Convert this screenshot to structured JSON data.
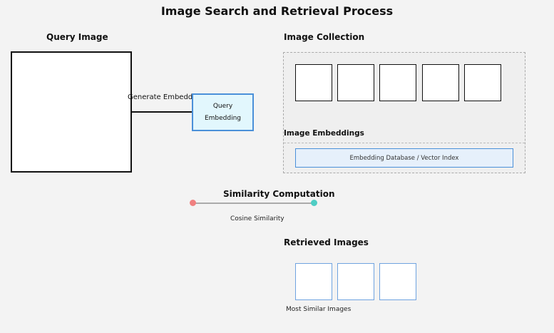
{
  "title": "Image Search and Retrieval Process",
  "query": {
    "label": "Query Image",
    "generate_label": "Generate Embeddings",
    "embedding_lines": [
      "Query",
      "Embedding"
    ]
  },
  "collection": {
    "label": "Image Collection",
    "thumbnail_count": 5,
    "embeddings_label": "Image Embeddings",
    "database_label": "Embedding Database / Vector Index"
  },
  "similarity": {
    "label": "Similarity Computation",
    "method_label": "Cosine Similarity",
    "colors": {
      "start": "#f08080",
      "end": "#4ecdc4",
      "line": "#aaaaaa"
    }
  },
  "retrieved": {
    "label": "Retrieved Images",
    "result_count": 3,
    "caption": "Most Similar Images"
  },
  "colors": {
    "accent": "#4a90d9",
    "embedding_fill": "#e2f7fd",
    "background": "#f3f3f3"
  }
}
